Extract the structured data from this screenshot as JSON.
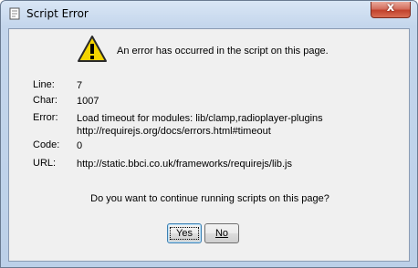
{
  "window": {
    "title": "Script Error",
    "close_glyph": "x",
    "icons": [
      "document-icon",
      "warning-icon"
    ]
  },
  "dialog": {
    "message": "An error has occurred in the script on this page.",
    "details": [
      {
        "label": "Line:",
        "value": "7"
      },
      {
        "label": "Char:",
        "value": "1007"
      },
      {
        "label": "Error:",
        "value": "Load timeout for modules: lib/clamp,radioplayer-plugins",
        "value2": "http://requirejs.org/docs/errors.html#timeout"
      },
      {
        "label": "Code:",
        "value": "0"
      },
      {
        "label": "URL:",
        "value": "http://static.bbci.co.uk/frameworks/requirejs/lib.js"
      }
    ],
    "question": "Do you want to continue running scripts on this page?",
    "yes_label": "Yes",
    "no_label": "No"
  },
  "colors": {
    "warning_yellow": "#f4d400",
    "close_red": "#c2422c",
    "dialog_bg": "#f0f0f0"
  }
}
